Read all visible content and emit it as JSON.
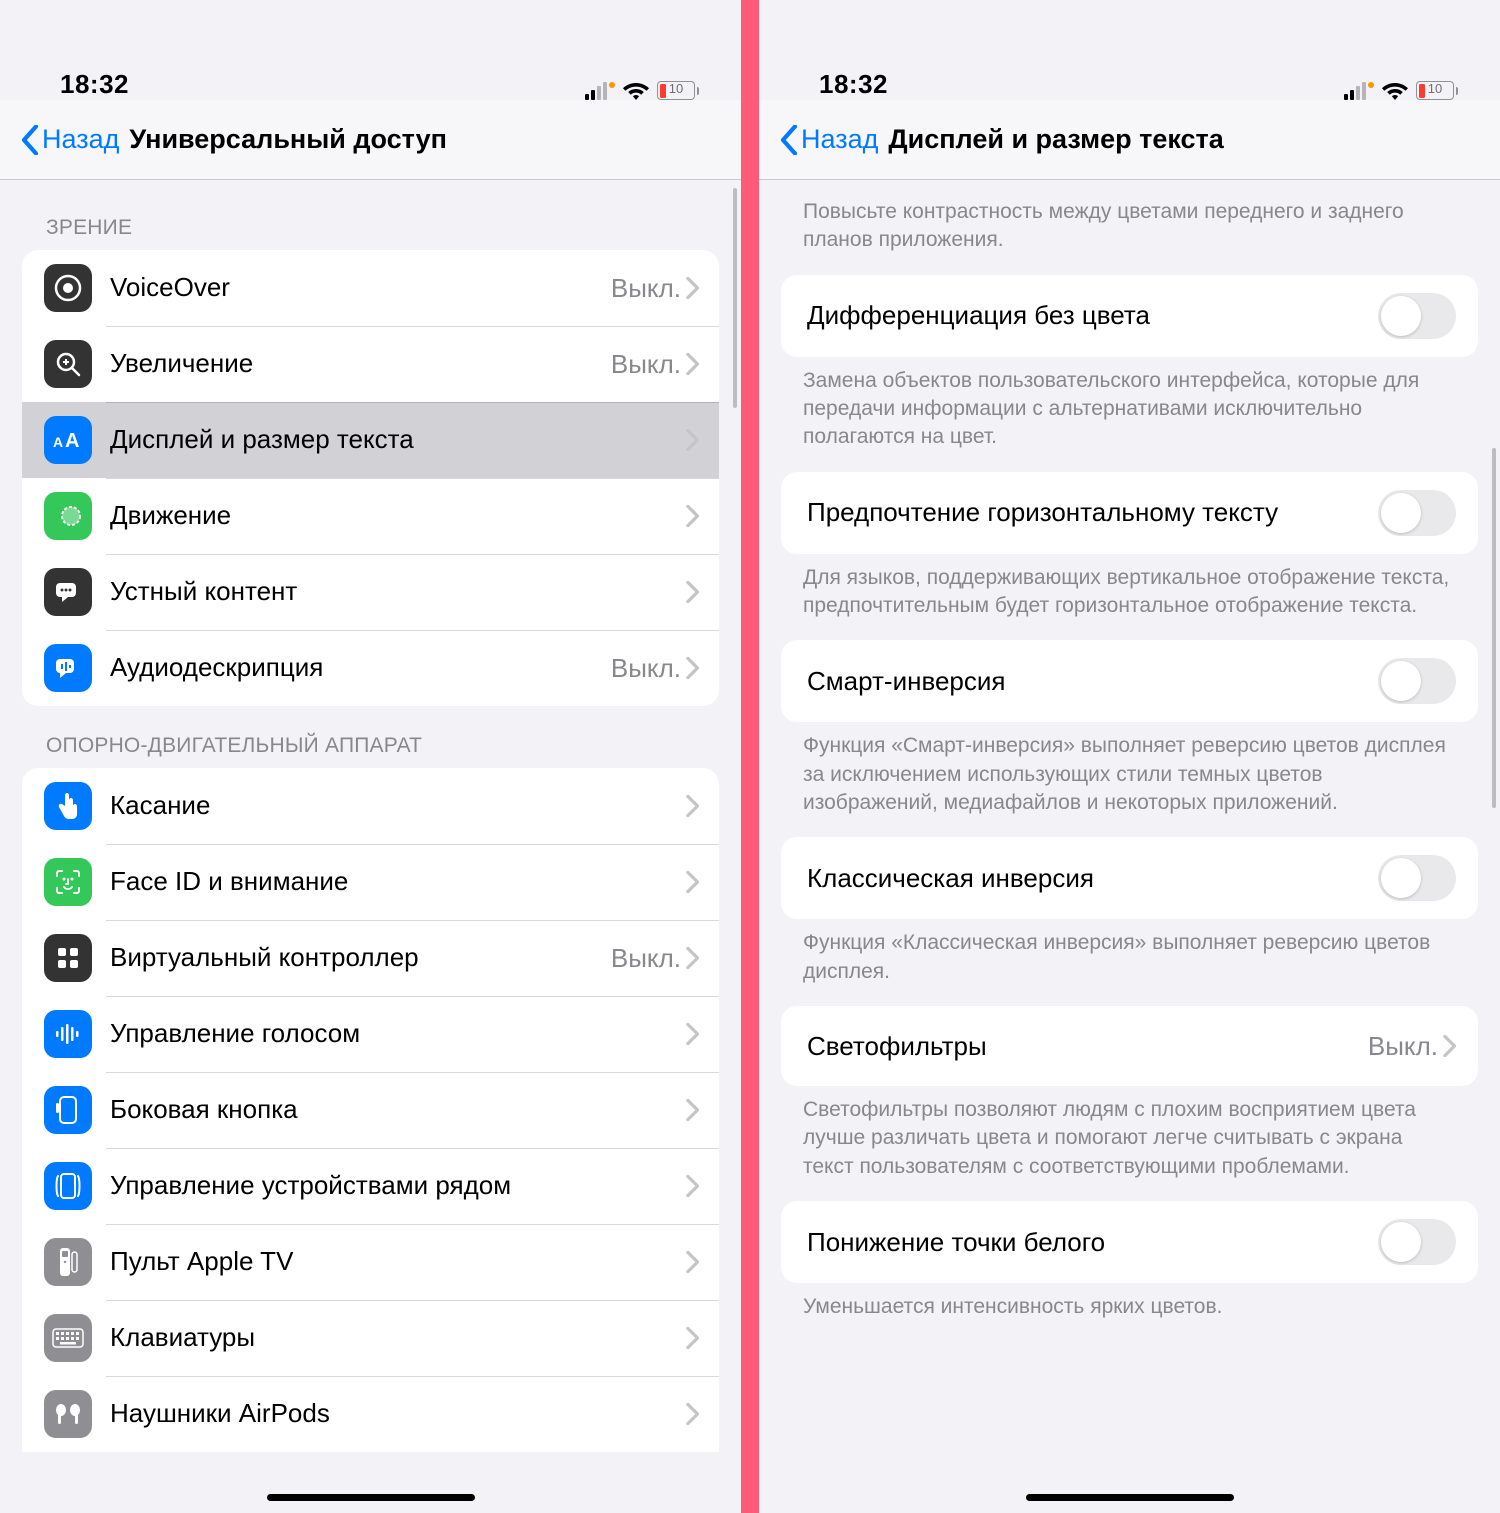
{
  "status": {
    "time": "18:32",
    "battery_pct": "10"
  },
  "left": {
    "back": "Назад",
    "title": "Универсальный доступ",
    "section1_header": "ЗРЕНИЕ",
    "section2_header": "ОПОРНО-ДВИГАТЕЛЬНЫЙ АППАРАТ",
    "vision": [
      {
        "label": "VoiceOver",
        "value": "Выкл.",
        "icon_bg": "#333",
        "selected": false
      },
      {
        "label": "Увеличение",
        "value": "Выкл.",
        "icon_bg": "#333",
        "selected": false
      },
      {
        "label": "Дисплей и размер текста",
        "value": "",
        "icon_bg": "#007aff",
        "selected": true
      },
      {
        "label": "Движение",
        "value": "",
        "icon_bg": "#34c759",
        "selected": false
      },
      {
        "label": "Устный контент",
        "value": "",
        "icon_bg": "#333",
        "selected": false
      },
      {
        "label": "Аудиодескрипция",
        "value": "Выкл.",
        "icon_bg": "#007aff",
        "selected": false
      }
    ],
    "motor": [
      {
        "label": "Касание",
        "value": "",
        "icon_bg": "#007aff"
      },
      {
        "label": "Face ID и внимание",
        "value": "",
        "icon_bg": "#34c759"
      },
      {
        "label": "Виртуальный контроллер",
        "value": "Выкл.",
        "icon_bg": "#333"
      },
      {
        "label": "Управление голосом",
        "value": "",
        "icon_bg": "#007aff"
      },
      {
        "label": "Боковая кнопка",
        "value": "",
        "icon_bg": "#007aff"
      },
      {
        "label": "Управление устройствами рядом",
        "value": "",
        "icon_bg": "#007aff"
      },
      {
        "label": "Пульт Apple TV",
        "value": "",
        "icon_bg": "#8e8e93"
      },
      {
        "label": "Клавиатуры",
        "value": "",
        "icon_bg": "#8e8e93"
      },
      {
        "label": "Наушники AirPods",
        "value": "",
        "icon_bg": "#8e8e93"
      }
    ]
  },
  "right": {
    "back": "Назад",
    "title": "Дисплей и размер текста",
    "top_footer": "Повысьте контрастность между цветами переднего и заднего планов приложения.",
    "rows": [
      {
        "label": "Дифференциация без цвета",
        "type": "toggle",
        "footer": "Замена объектов пользовательского интерфейса, которые для передачи информации с альтернативами исключительно полагаются на цвет."
      },
      {
        "label": "Предпочтение горизонтальному тексту",
        "type": "toggle",
        "footer": "Для языков, поддерживающих вертикальное отображение текста, предпочтительным будет горизонтальное отображение текста."
      },
      {
        "label": "Смарт-инверсия",
        "type": "toggle",
        "footer": "Функция «Смарт-инверсия» выполняет реверсию цветов дисплея за исключением использующих стили темных цветов изображений, медиафайлов и некоторых приложений."
      },
      {
        "label": "Классическая инверсия",
        "type": "toggle",
        "footer": "Функция «Классическая инверсия» выполняет реверсию цветов дисплея."
      },
      {
        "label": "Светофильтры",
        "type": "nav",
        "value": "Выкл.",
        "footer": "Светофильтры позволяют людям с плохим восприятием цвета лучше различать цвета и помогают легче считывать с экрана текст пользователям с соответствующими проблемами."
      },
      {
        "label": "Понижение точки белого",
        "type": "toggle",
        "footer": "Уменьшается интенсивность ярких цветов."
      }
    ]
  }
}
